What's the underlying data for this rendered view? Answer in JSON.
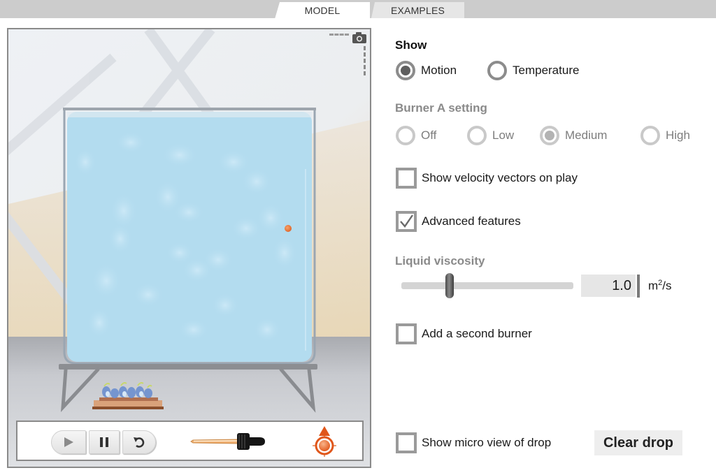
{
  "tabs": [
    {
      "label": "MODEL",
      "active": true
    },
    {
      "label": "EXAMPLES",
      "active": false
    }
  ],
  "simulation": {
    "camera_icon": "camera-icon",
    "controls": {
      "play_icon": "play-icon",
      "pause_icon": "pause-icon",
      "reset_icon": "reset-icon",
      "dropper_icon": "dropper-icon",
      "drop_target_icon": "drop-target-icon"
    },
    "colors": {
      "water": "#b3dcef",
      "drop": "#e8783a",
      "accent_orange": "#e05a1c"
    }
  },
  "panel": {
    "show": {
      "heading": "Show",
      "options": [
        {
          "label": "Motion",
          "selected": true
        },
        {
          "label": "Temperature",
          "selected": false
        }
      ]
    },
    "burner": {
      "heading": "Burner A setting",
      "disabled": true,
      "options": [
        {
          "label": "Off",
          "selected": false
        },
        {
          "label": "Low",
          "selected": false
        },
        {
          "label": "Medium",
          "selected": true
        },
        {
          "label": "High",
          "selected": false
        }
      ]
    },
    "velocity_vectors": {
      "label": "Show velocity vectors on play",
      "checked": false
    },
    "advanced_features": {
      "label": "Advanced features",
      "checked": true
    },
    "viscosity": {
      "heading": "Liquid viscosity",
      "value": "1.0",
      "unit_base": "m",
      "unit_exp": "2",
      "unit_tail": "/s",
      "slider_fraction": 0.28
    },
    "second_burner": {
      "label": "Add a second burner",
      "checked": false
    },
    "micro_view": {
      "label": "Show micro view of drop",
      "checked": false
    },
    "clear_drop_label": "Clear drop"
  }
}
